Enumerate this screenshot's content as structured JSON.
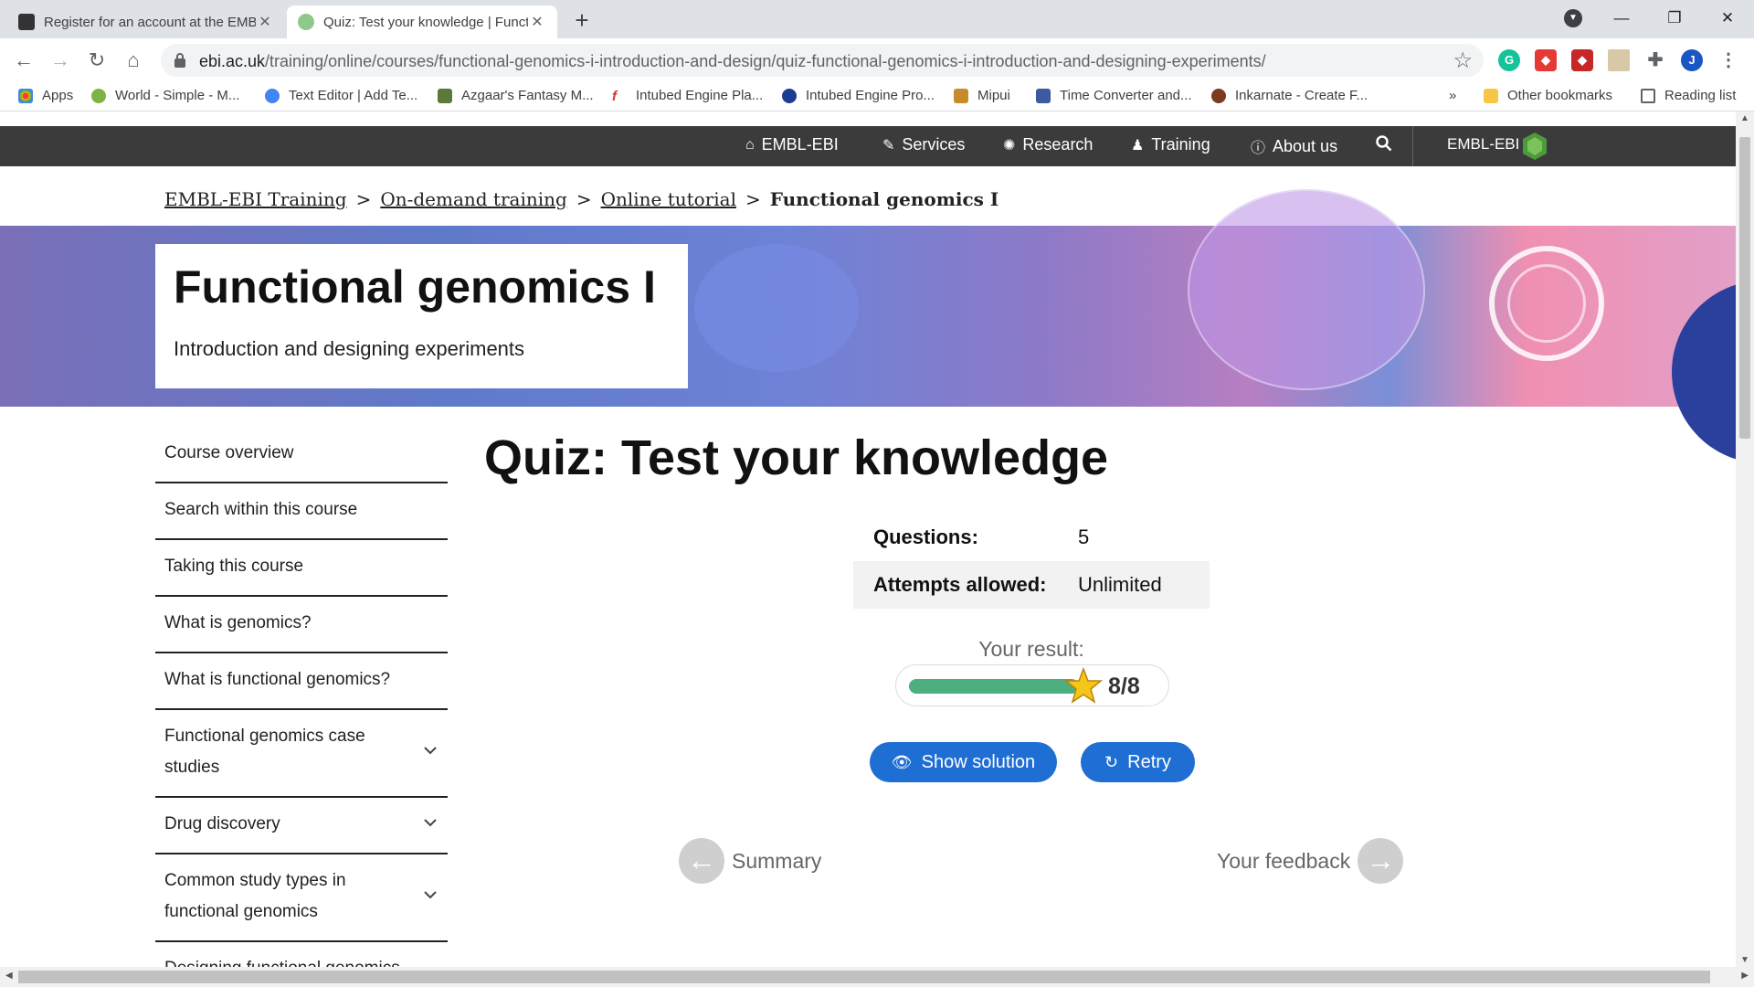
{
  "browser": {
    "tabs": [
      {
        "title": "Register for an account at the EMBL-EBI",
        "active": false
      },
      {
        "title": "Quiz: Test your knowledge | Functional genomics",
        "active": true
      }
    ],
    "new_tab": "+",
    "window_controls": {
      "minimize": "—",
      "restore": "❐",
      "close": "✕"
    },
    "url_host": "ebi.ac.uk",
    "url_path": "/training/online/courses/functional-genomics-i-introduction-and-design/quiz-functional-genomics-i-introduction-and-designing-experiments/",
    "profile_initial": "J",
    "ext_grammarly": "G",
    "bookmarks": [
      {
        "label": "Apps",
        "color": "#ea4335"
      },
      {
        "label": "World - Simple - M...",
        "color": "#7cb342"
      },
      {
        "label": "Text Editor | Add Te...",
        "color": "#4285f4"
      },
      {
        "label": "Azgaar's Fantasy M...",
        "color": "#5b7a3a"
      },
      {
        "label": "Intubed Engine Pla...",
        "color": "#d93025"
      },
      {
        "label": "Intubed Engine Pro...",
        "color": "#1a3d8f"
      },
      {
        "label": "Mipui",
        "color": "#c98a2b"
      },
      {
        "label": "Time Converter and...",
        "color": "#3b5aa0"
      },
      {
        "label": "Inkarnate - Create F...",
        "color": "#7a3b20"
      }
    ],
    "bookmarks_overflow": "»",
    "other_bookmarks": "Other bookmarks",
    "reading_list": "Reading list"
  },
  "site": {
    "topnav": {
      "home": "EMBL-EBI",
      "services": "Services",
      "research": "Research",
      "training": "Training",
      "about": "About us",
      "brand": "EMBL-EBI"
    },
    "breadcrumb": {
      "items": [
        "EMBL-EBI Training",
        "On-demand training",
        "Online tutorial"
      ],
      "current": "Functional genomics I",
      "separator": ">"
    },
    "hero": {
      "title": "Functional genomics I",
      "subtitle": "Introduction and designing experiments"
    },
    "sidebar": [
      {
        "label": "Course overview",
        "expandable": false
      },
      {
        "label": "Search within this course",
        "expandable": false
      },
      {
        "label": "Taking this course",
        "expandable": false
      },
      {
        "label": "What is genomics?",
        "expandable": false
      },
      {
        "label": "What is functional genomics?",
        "expandable": false
      },
      {
        "label": "Functional genomics case studies",
        "expandable": true
      },
      {
        "label": "Drug discovery",
        "expandable": true
      },
      {
        "label": "Common study types in functional genomics",
        "expandable": true
      },
      {
        "label": "Designing functional genomics experiments",
        "expandable": true
      }
    ],
    "quiz": {
      "title": "Quiz: Test your knowledge",
      "questions_label": "Questions:",
      "questions_value": "5",
      "attempts_label": "Attempts allowed:",
      "attempts_value": "Unlimited",
      "result_label": "Your result:",
      "score": "8/8",
      "score_fraction": 1.0,
      "show_solution": "Show solution",
      "retry": "Retry",
      "prev": "Summary",
      "next": "Your feedback"
    },
    "colors": {
      "nav_bg": "#3b3b3b",
      "button_blue": "#1f6ed4",
      "progress_green": "#4caf7d",
      "star_gold": "#f5c518"
    }
  }
}
